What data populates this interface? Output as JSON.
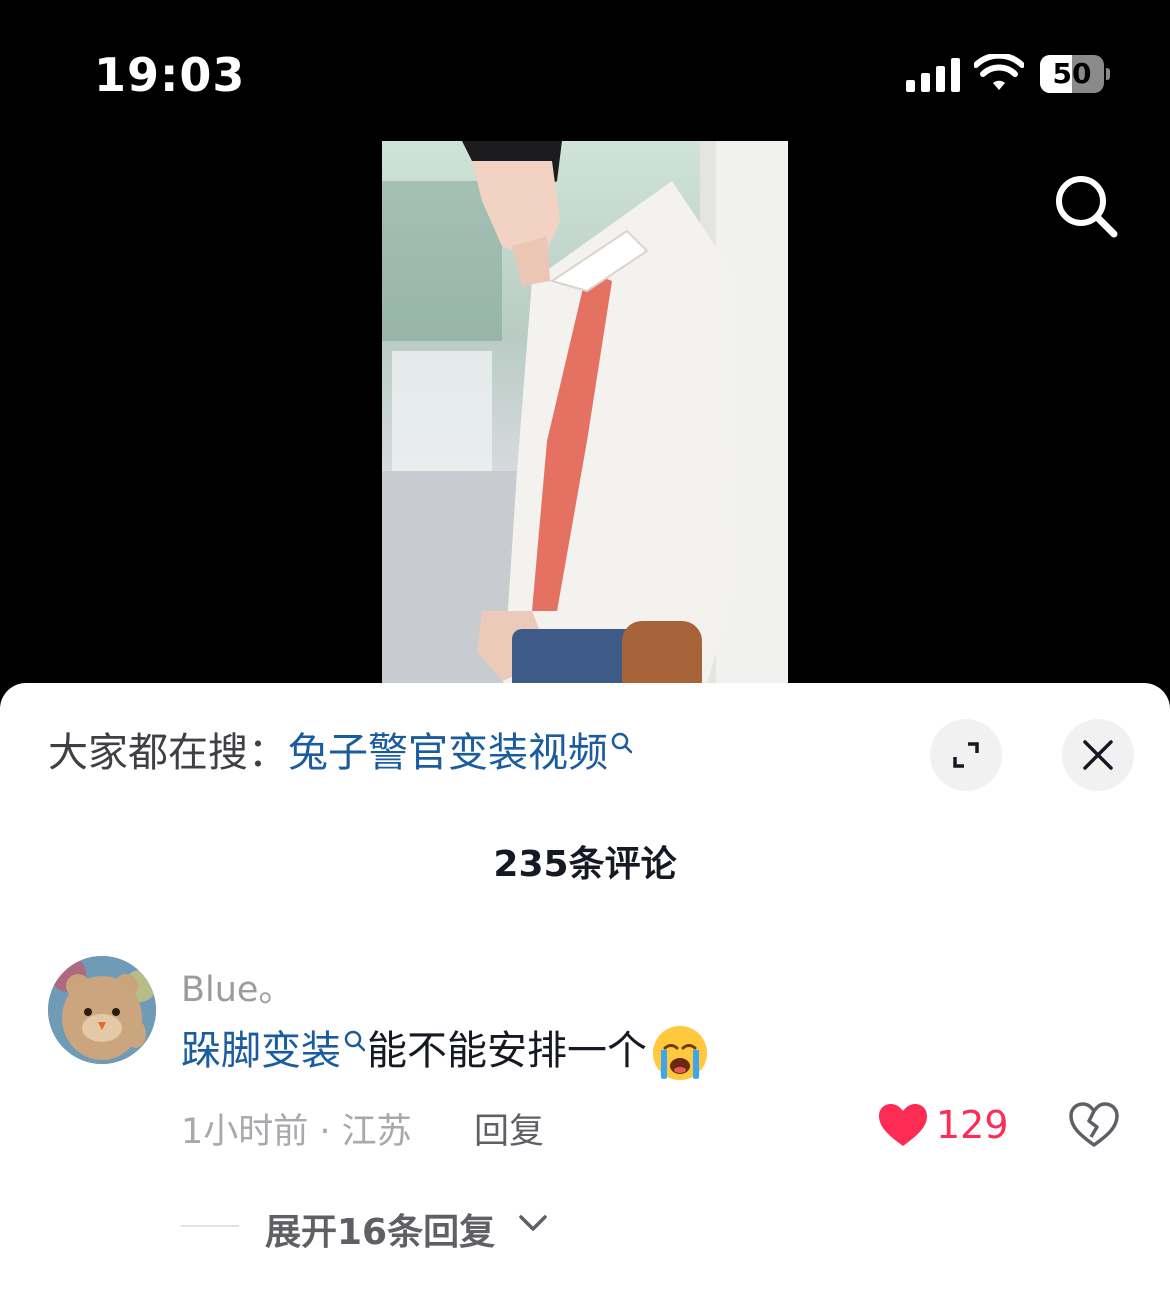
{
  "status_bar": {
    "time": "19:03",
    "battery": "50",
    "battery_level": 0.5
  },
  "video": {
    "search_icon": "magnifier-icon"
  },
  "comments_sheet": {
    "trending_prefix": "大家都在搜：",
    "trending_keyword": "兔子警官变装视频",
    "expand_icon": "expand-arrows-icon",
    "close_icon": "close-x-icon",
    "count_label": "235条评论",
    "comments": [
      {
        "username": "Blue。",
        "keyword": "跺脚变装",
        "text": "能不能安排一个",
        "emoji": "crying-face",
        "time_location": "1小时前 · 江苏",
        "reply_label": "回复",
        "likes": "129",
        "expand_replies": "展开16条回复"
      }
    ]
  },
  "colors": {
    "link_blue": "#1a5c9e",
    "like_red": "#fe2c55"
  }
}
